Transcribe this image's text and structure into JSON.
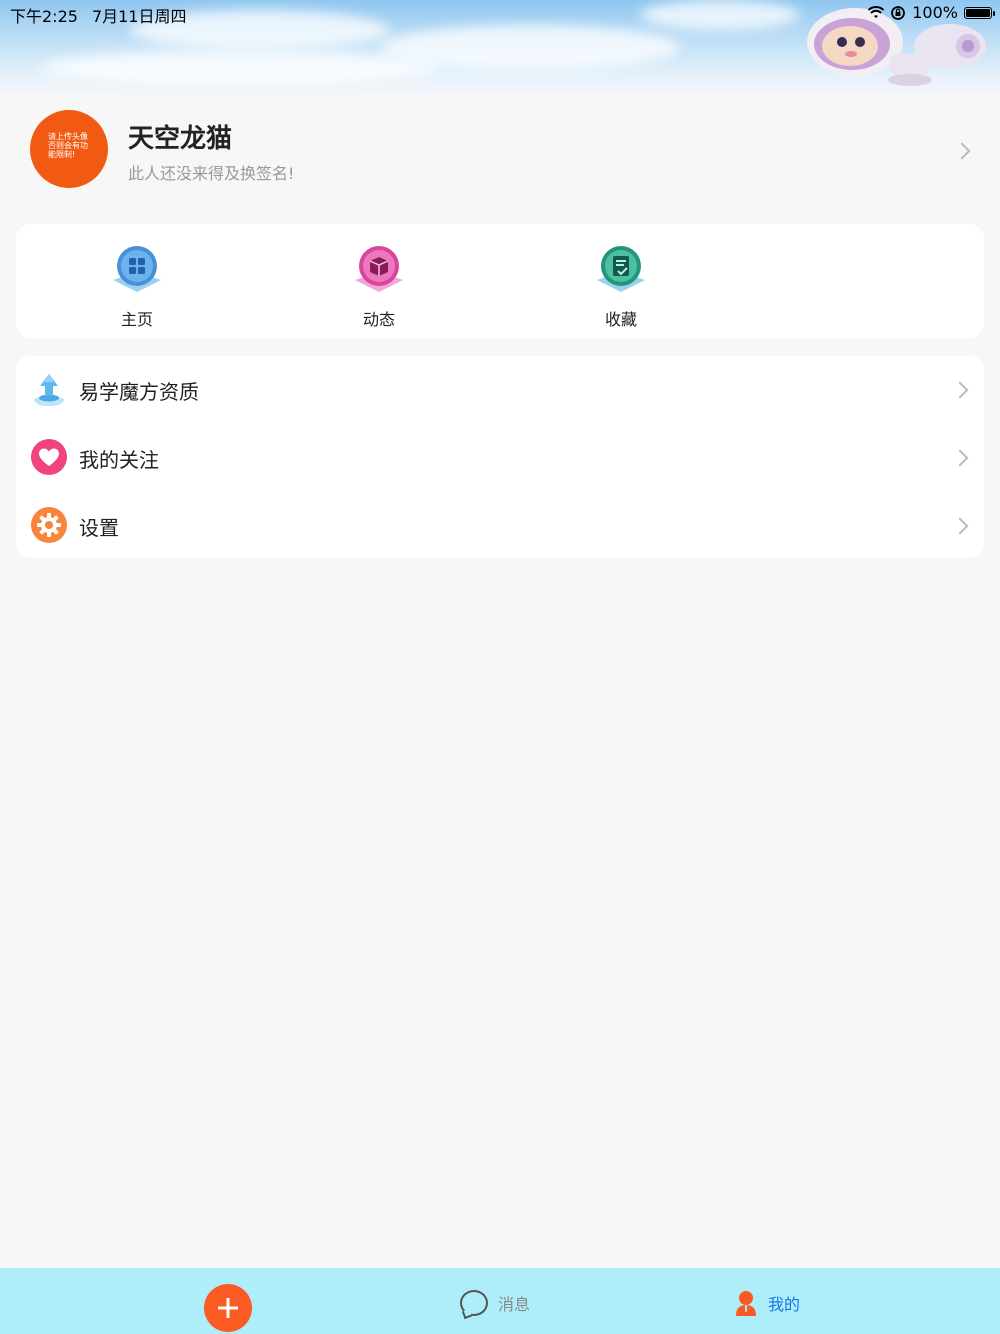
{
  "status_bar": {
    "time": "下午2:25",
    "date": "7月11日周四",
    "battery": "100%",
    "battery_level": 1.0
  },
  "profile": {
    "avatar_text": "请上传头像否则会有功能限制!",
    "username": "天空龙猫",
    "signature": "此人还没来得及换签名!"
  },
  "quick_actions": [
    {
      "label": "主页",
      "icon": "grid-icon"
    },
    {
      "label": "动态",
      "icon": "cube-icon"
    },
    {
      "label": "收藏",
      "icon": "document-check-icon"
    }
  ],
  "menu": [
    {
      "label": "易学魔方资质",
      "icon": "qualification-icon"
    },
    {
      "label": "我的关注",
      "icon": "heart-icon"
    },
    {
      "label": "设置",
      "icon": "gear-icon"
    }
  ],
  "tabbar": {
    "messages_label": "消息",
    "mine_label": "我的",
    "active_color": "#1a73e8",
    "inactive_color": "#888888"
  },
  "colors": {
    "accent_orange": "#fb5a22",
    "tabbar_bg": "#aeeefa"
  }
}
